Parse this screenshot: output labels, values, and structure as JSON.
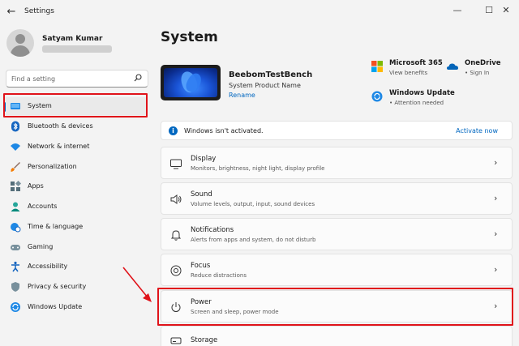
{
  "window": {
    "title": "Settings",
    "back_glyph": "←",
    "minimize_glyph": "—",
    "maximize_glyph": "☐",
    "close_glyph": "✕"
  },
  "profile": {
    "name": "Satyam Kumar"
  },
  "search": {
    "placeholder": "Find a setting"
  },
  "sidebar": {
    "items": [
      {
        "label": "System",
        "icon": "monitor-icon",
        "active": true
      },
      {
        "label": "Bluetooth & devices",
        "icon": "bluetooth-icon"
      },
      {
        "label": "Network & internet",
        "icon": "wifi-icon"
      },
      {
        "label": "Personalization",
        "icon": "brush-icon"
      },
      {
        "label": "Apps",
        "icon": "apps-icon"
      },
      {
        "label": "Accounts",
        "icon": "person-icon"
      },
      {
        "label": "Time & language",
        "icon": "globe-clock-icon"
      },
      {
        "label": "Gaming",
        "icon": "gamepad-icon"
      },
      {
        "label": "Accessibility",
        "icon": "accessibility-icon"
      },
      {
        "label": "Privacy & security",
        "icon": "shield-icon"
      },
      {
        "label": "Windows Update",
        "icon": "sync-icon"
      }
    ]
  },
  "main": {
    "title": "System",
    "device": {
      "name": "BeebomTestBench",
      "subtitle": "System Product Name",
      "rename": "Rename"
    },
    "quick": {
      "m365": {
        "title": "Microsoft 365",
        "sub": "View benefits"
      },
      "onedrive": {
        "title": "OneDrive",
        "sub": "• Sign In"
      },
      "update": {
        "title": "Windows Update",
        "sub": "• Attention needed"
      }
    },
    "banner": {
      "text": "Windows isn't activated.",
      "link": "Activate now",
      "icon_glyph": "i"
    },
    "cards": [
      {
        "title": "Display",
        "sub": "Monitors, brightness, night light, display profile",
        "icon": "display-icon"
      },
      {
        "title": "Sound",
        "sub": "Volume levels, output, input, sound devices",
        "icon": "speaker-icon"
      },
      {
        "title": "Notifications",
        "sub": "Alerts from apps and system, do not disturb",
        "icon": "bell-icon"
      },
      {
        "title": "Focus",
        "sub": "Reduce distractions",
        "icon": "focus-icon"
      },
      {
        "title": "Power",
        "sub": "Screen and sleep, power mode",
        "icon": "power-icon"
      },
      {
        "title": "Storage",
        "sub": "",
        "icon": "storage-icon"
      }
    ],
    "chevron_glyph": "›"
  },
  "colors": {
    "accent": "#0067c0",
    "highlight": "#e0131a"
  }
}
